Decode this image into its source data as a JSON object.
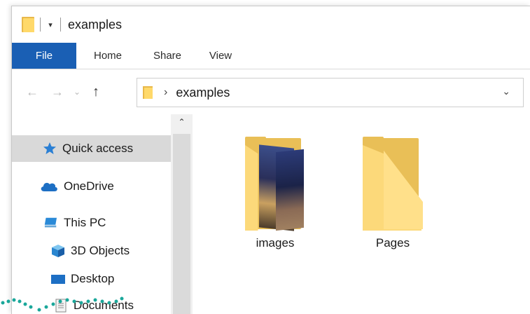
{
  "window": {
    "title": "examples",
    "quick_access_glyph": "▾"
  },
  "ribbon": {
    "tabs": [
      {
        "label": "File"
      },
      {
        "label": "Home"
      },
      {
        "label": "Share"
      },
      {
        "label": "View"
      }
    ]
  },
  "nav": {
    "back_icon": "←",
    "forward_icon": "→",
    "recent_icon": "⌄",
    "up_icon": "↑"
  },
  "address": {
    "chevron": "›",
    "path": "examples",
    "dropdown": "⌄"
  },
  "sidebar": {
    "scroll_up": "⌃",
    "items": [
      {
        "label": "Quick access",
        "icon": "star-icon",
        "selected": true
      },
      {
        "label": "OneDrive",
        "icon": "cloud-icon"
      },
      {
        "label": "This PC",
        "icon": "computer-icon"
      },
      {
        "label": "3D Objects",
        "icon": "cube-icon"
      },
      {
        "label": "Desktop",
        "icon": "desktop-icon"
      },
      {
        "label": "Documents",
        "icon": "document-icon"
      }
    ]
  },
  "content": {
    "items": [
      {
        "label": "images",
        "type": "folder-with-images"
      },
      {
        "label": "Pages",
        "type": "folder"
      }
    ]
  },
  "colors": {
    "file_tab": "#1a5fb4",
    "folder_back": "#e9bf57",
    "folder_front": "#fcd97a",
    "selected_bg": "#d9d9d9"
  }
}
